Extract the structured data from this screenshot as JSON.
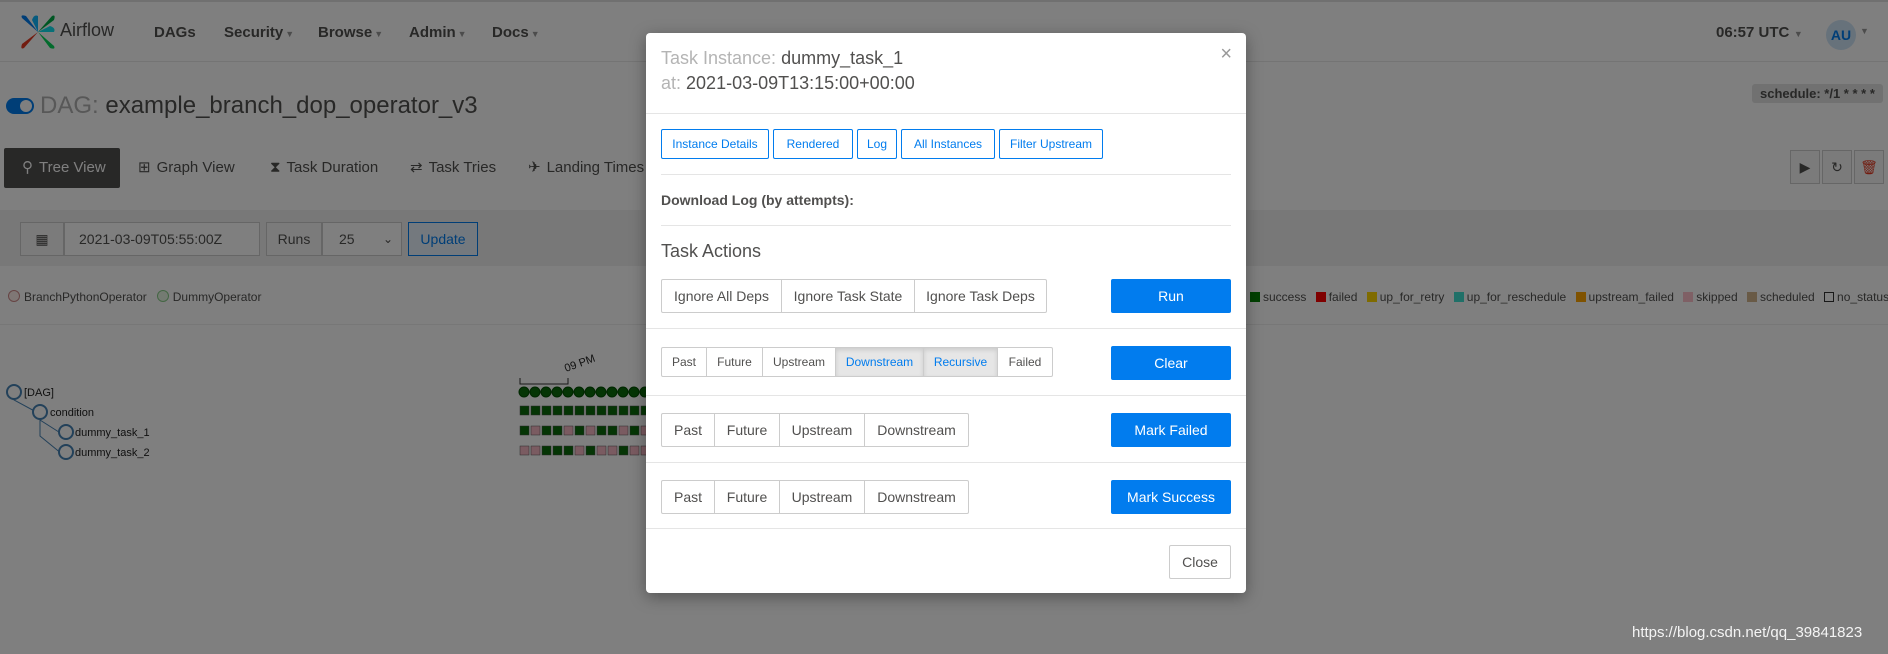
{
  "navbar": {
    "brand": "Airflow",
    "items": [
      {
        "label": "DAGs",
        "caret": false
      },
      {
        "label": "Security",
        "caret": true
      },
      {
        "label": "Browse",
        "caret": true
      },
      {
        "label": "Admin",
        "caret": true
      },
      {
        "label": "Docs",
        "caret": true
      }
    ],
    "clock": "06:57 UTC",
    "user_initials": "AU"
  },
  "dag": {
    "prefix": "DAG:",
    "name": "example_branch_dop_operator_v3",
    "schedule": "schedule: */1 * * * *"
  },
  "view_tabs": [
    {
      "label": "Tree View",
      "icon": "tree-icon",
      "active": true
    },
    {
      "label": "Graph View",
      "icon": "graph-icon",
      "active": false
    },
    {
      "label": "Task Duration",
      "icon": "hourglass-icon",
      "active": false
    },
    {
      "label": "Task Tries",
      "icon": "retry-icon",
      "active": false
    },
    {
      "label": "Landing Times",
      "icon": "landing-icon",
      "active": false
    }
  ],
  "filters": {
    "date": "2021-03-09T05:55:00Z",
    "runs_label": "Runs",
    "runs_value": "25",
    "update_label": "Update"
  },
  "operators": [
    {
      "label": "BranchPythonOperator",
      "color": "#ffefeb"
    },
    {
      "label": "DummyOperator",
      "color": "#e8f7e4"
    }
  ],
  "states": [
    {
      "label": "success",
      "color": "#008000"
    },
    {
      "label": "failed",
      "color": "#ff0000"
    },
    {
      "label": "up_for_retry",
      "color": "#ffd700"
    },
    {
      "label": "up_for_reschedule",
      "color": "#40e0d0"
    },
    {
      "label": "upstream_failed",
      "color": "#ffa500"
    },
    {
      "label": "skipped",
      "color": "#ffc0cb"
    },
    {
      "label": "scheduled",
      "color": "#d2b48c"
    },
    {
      "label": "no_status",
      "color": "#ffffff"
    }
  ],
  "tree": {
    "time_label": "09 PM",
    "nodes": [
      "[DAG]",
      "condition",
      "dummy_task_1",
      "dummy_task_2"
    ]
  },
  "modal": {
    "ti_label": "Task Instance:",
    "ti_value": "dummy_task_1",
    "at_label": "at:",
    "at_value": "2021-03-09T13:15:00+00:00",
    "top_buttons": [
      "Instance Details",
      "Rendered",
      "Log",
      "All Instances",
      "Filter Upstream"
    ],
    "download_log_label": "Download Log (by attempts):",
    "task_actions_title": "Task Actions",
    "run_options": [
      "Ignore All Deps",
      "Ignore Task State",
      "Ignore Task Deps"
    ],
    "run_label": "Run",
    "clear_options": [
      {
        "label": "Past",
        "pressed": false
      },
      {
        "label": "Future",
        "pressed": false
      },
      {
        "label": "Upstream",
        "pressed": false
      },
      {
        "label": "Downstream",
        "pressed": true
      },
      {
        "label": "Recursive",
        "pressed": true
      },
      {
        "label": "Failed",
        "pressed": false
      }
    ],
    "clear_label": "Clear",
    "mark_failed_options": [
      "Past",
      "Future",
      "Upstream",
      "Downstream"
    ],
    "mark_failed_label": "Mark Failed",
    "mark_success_options": [
      "Past",
      "Future",
      "Upstream",
      "Downstream"
    ],
    "mark_success_label": "Mark Success",
    "close_label": "Close"
  },
  "watermark": "https://blog.csdn.net/qq_39841823"
}
